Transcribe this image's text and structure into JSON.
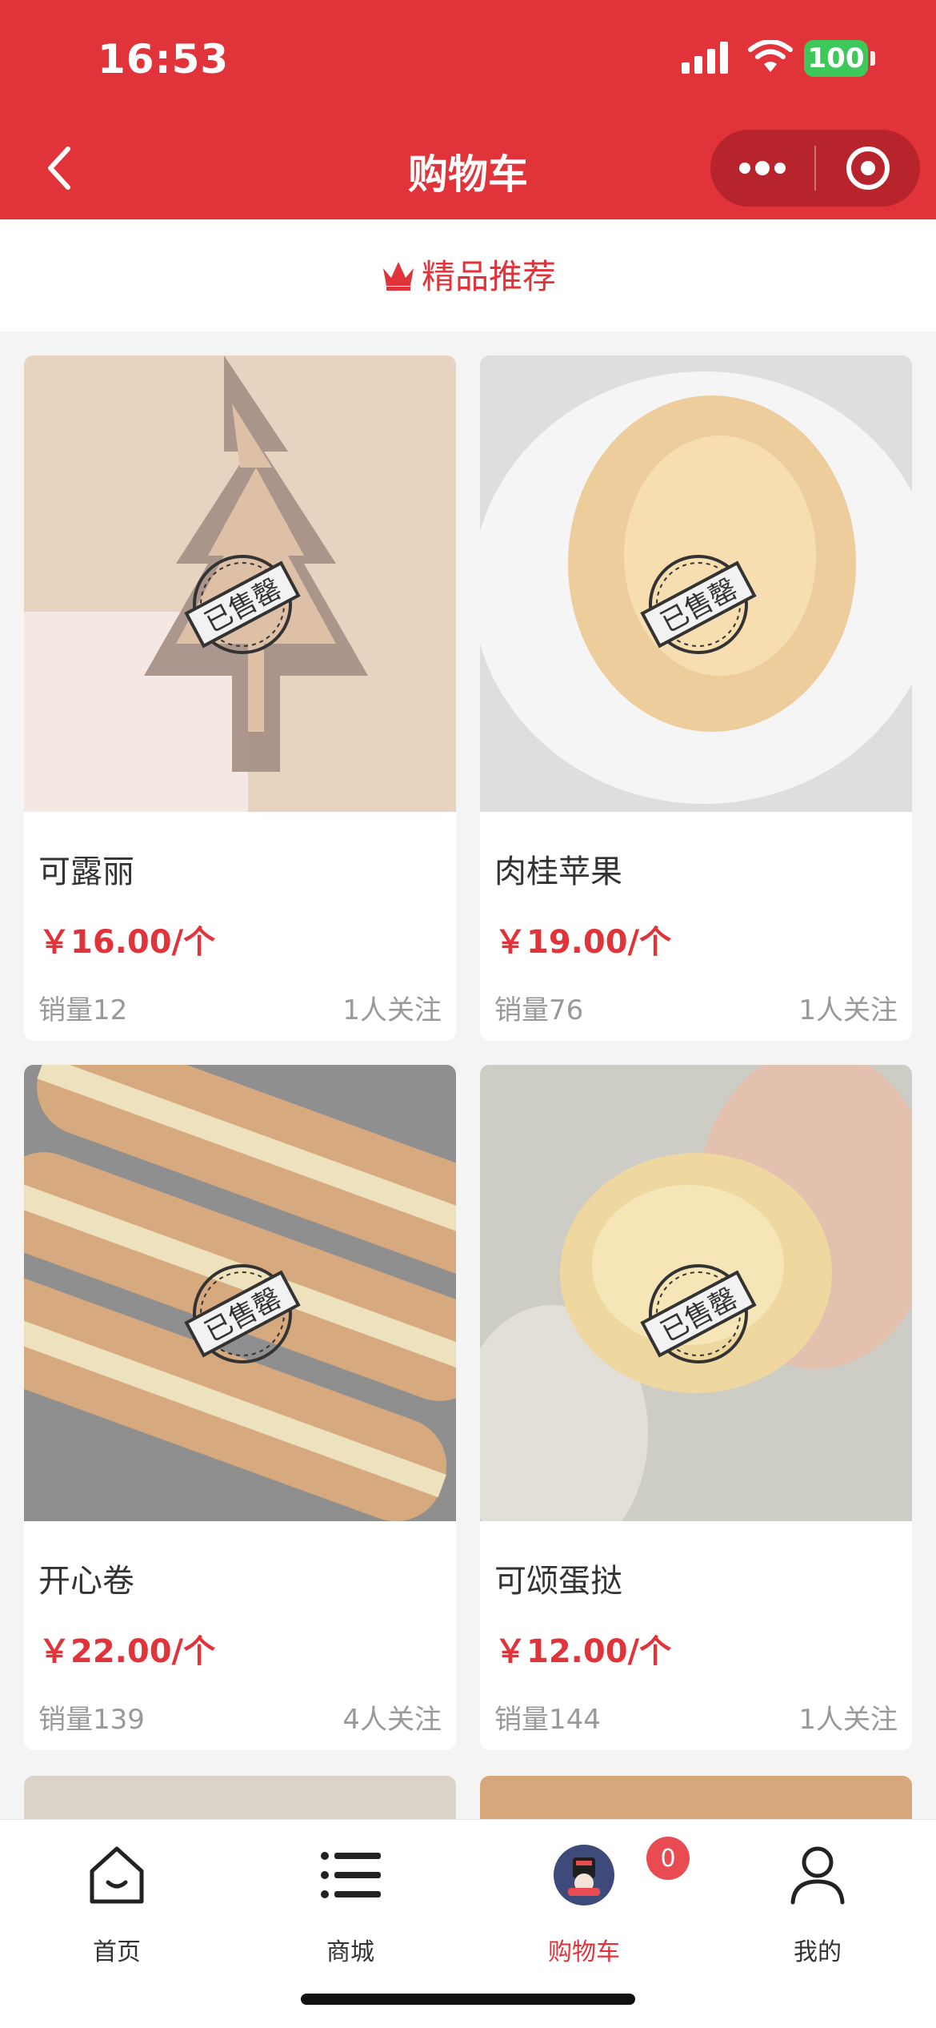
{
  "status_bar": {
    "time": "16:53",
    "battery": "100"
  },
  "navbar": {
    "title": "购物车"
  },
  "section": {
    "title": "精品推荐"
  },
  "products": [
    {
      "name": "可露丽",
      "price": "￥16.00/个",
      "sales": "销量12",
      "follow": "1人关注",
      "stamp": "已售罄"
    },
    {
      "name": "肉桂苹果",
      "price": "￥19.00/个",
      "sales": "销量76",
      "follow": "1人关注",
      "stamp": "已售罄"
    },
    {
      "name": "开心卷",
      "price": "￥22.00/个",
      "sales": "销量139",
      "follow": "4人关注",
      "stamp": "已售罄"
    },
    {
      "name": "可颂蛋挞",
      "price": "￥12.00/个",
      "sales": "销量144",
      "follow": "1人关注",
      "stamp": "已售罄"
    }
  ],
  "tabbar": {
    "items": [
      {
        "label": "首页"
      },
      {
        "label": "商城"
      },
      {
        "label": "购物车"
      },
      {
        "label": "我的"
      }
    ],
    "cart_badge": "0"
  },
  "colors": {
    "brand": "#e0333a",
    "muted": "#999999"
  }
}
